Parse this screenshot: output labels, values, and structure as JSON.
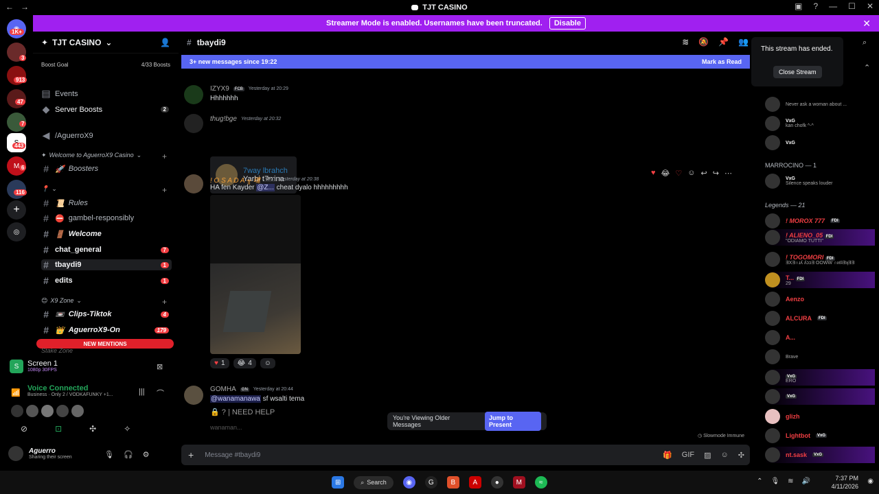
{
  "titlebar": {
    "title": "TJT CASINO"
  },
  "streamer_banner": {
    "text": "Streamer Mode is enabled. Usernames have been truncated.",
    "button": "Disable"
  },
  "servers": [
    {
      "badge": "1K+"
    },
    {
      "badge": "3"
    },
    {
      "badge": "913"
    },
    {
      "badge": "47"
    },
    {
      "badge": "7"
    },
    {
      "badge": "443"
    },
    {
      "badge": "6"
    },
    {
      "badge": "116"
    }
  ],
  "guild": {
    "name": "TJT CASINO",
    "boost_goal": "Boost Goal",
    "boost_count": "4/33 Boosts",
    "events": "Events",
    "server_boosts": "Server Boosts",
    "server_boosts_count": "2",
    "channel_aguerro": "/AguerroX9",
    "category_welcome": "Welcome to AguerroX9 Casino",
    "boosters": "Boosters",
    "rules": "Rules",
    "gambel": "gambel-responsibly",
    "welcome": "Welcome",
    "chat_general": "chat_general",
    "chat_general_count": "7",
    "tbaydi9": "tbaydi9",
    "tbaydi9_count": "1",
    "edits": "edits",
    "edits_count": "1",
    "category_x9": "X9 Zone",
    "clips": "Clips-Tiktok",
    "clips_count": "4",
    "aguerro_on": "AguerroX9-On",
    "aguerro_on_count": "179",
    "category_stake": "Stake Zone",
    "new_mentions": "NEW MENTIONS"
  },
  "panel": {
    "screen": "Screen 1",
    "screen_sub": "1080p 30FPS",
    "voice": "Voice Connected",
    "voice_sub": "Business · Only 2 / VODKAFUNKY +1...",
    "user": "Aguerro",
    "user_status": "Sharing their screen"
  },
  "chat": {
    "channel": "tbaydi9",
    "new_messages": "3+ new messages since 19:22",
    "mark_read": "Mark as Read",
    "messages": [
      {
        "user": "IZYX9",
        "tag": "FCB",
        "time": "Yesterday at 20:29",
        "text": "Hhhhhhh"
      },
      {
        "user": "thug!bge",
        "time": "Yesterday at 20:32",
        "reply_name": "7way lbrahch",
        "reply_text": "Yarbi t7wina"
      },
      {
        "user": "! O S A D A ╥ 魂",
        "tag": "VF1",
        "time": "Yesterday at 20:38",
        "text_before": "HA fen Kayder ",
        "mention": "@Z...",
        "text_after": " cheat dyalo hhhhhhhhh"
      },
      {
        "user": "GOMHA",
        "tag": "GN",
        "time": "Yesterday at 20:44",
        "mention": "@wanamanawa",
        "text_after": " sf wsalti tema",
        "extra": "| NEED HELP",
        "extra2": "wanaman..."
      }
    ],
    "reactions": [
      {
        "emoji": "♥",
        "count": "1"
      },
      {
        "emoji": "😂",
        "count": "4"
      }
    ],
    "older": "You're Viewing Older Messages",
    "jump": "Jump to Present",
    "slowmode": "Slowmode Immune",
    "placeholder": "Message #tbaydi9"
  },
  "members": {
    "stream_ended": "This stream has ended.",
    "close_stream": "Close Stream",
    "top": [
      {
        "name": "",
        "sub": "Never ask a woman about ..."
      },
      {
        "name": "VxG",
        "sub": "kan chofk ^-^"
      },
      {
        "name": "VxG",
        "sub": ""
      }
    ],
    "group_marrocino": "MARROCINO — 1",
    "marrocino": [
      {
        "name": "VxG",
        "sub": "Silence speaks louder"
      }
    ],
    "group_legends": "Legends — 21",
    "legends": [
      {
        "name": "! MOROX 777",
        "tag": "FDI",
        "sub": ""
      },
      {
        "name": "! ALIENO_05",
        "tag": "FDI",
        "sub": "\"ODIAMO TUTTI\""
      },
      {
        "name": "! TOGOMORI",
        "tag": "FDI",
        "sub": "ƎXƎ∩ɹʎ ʎɔɔƎ OOWW ∩ᴎIʇƎʞƎƎ"
      },
      {
        "name": "T...",
        "tag": "FDI",
        "sub": "29"
      },
      {
        "name": "Aenzo",
        "tag": "",
        "sub": ""
      },
      {
        "name": "ALCURA",
        "tag": "FDI",
        "sub": ""
      },
      {
        "name": "A...",
        "tag": "",
        "sub": ""
      },
      {
        "name": "",
        "tag": "",
        "sub": "Brave"
      },
      {
        "name": "VxG",
        "tag": "",
        "sub": "ERO"
      },
      {
        "name": "",
        "tag": "VxG",
        "sub": ""
      },
      {
        "name": "glizh",
        "tag": "",
        "sub": ""
      },
      {
        "name": "Lightbot",
        "tag": "VxG",
        "sub": ""
      },
      {
        "name": "nt.sask",
        "tag": "VxG",
        "sub": ""
      }
    ]
  },
  "taskbar": {
    "search": "Search",
    "time": "7:37 PM",
    "date": "4/11/2026"
  },
  "colors": {
    "accent": "#5865f2",
    "banner": "#a020f0",
    "danger": "#f23f43",
    "online": "#23a55a"
  }
}
